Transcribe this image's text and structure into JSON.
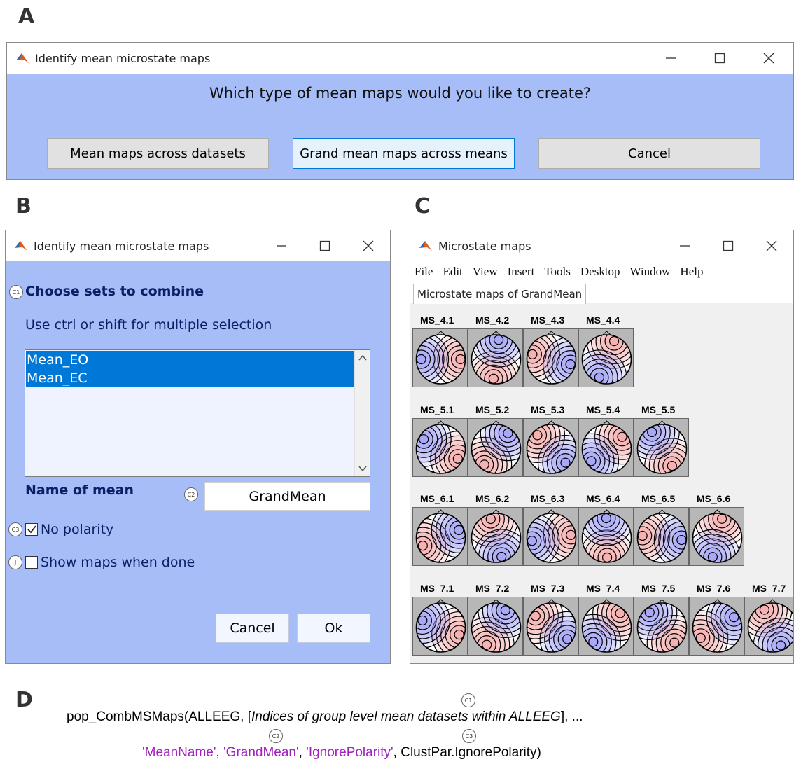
{
  "panel_letters": [
    "A",
    "B",
    "C",
    "D"
  ],
  "panel_a": {
    "window_title": "Identify mean microstate maps",
    "question": "Which type of mean maps would you like to create?",
    "buttons": [
      "Mean maps across datasets",
      "Grand mean maps across means",
      "Cancel"
    ],
    "focused_button": "Grand mean maps across means"
  },
  "panel_b": {
    "window_title": "Identify mean microstate maps",
    "heading": "Choose sets to combine",
    "heading_marker": "C1",
    "instruction": "Use ctrl or shift for multiple selection",
    "list_items": [
      "Mean_EO",
      "Mean_EC"
    ],
    "selected_items": [
      "Mean_EO",
      "Mean_EC"
    ],
    "name_label": "Name of mean",
    "name_marker": "C2",
    "name_value": "GrandMean",
    "no_polarity_label": "No polarity",
    "no_polarity_checked": true,
    "no_polarity_marker": "C3",
    "show_maps_label": "Show maps when done",
    "show_maps_checked": false,
    "show_maps_marker": "J",
    "cancel_label": "Cancel",
    "ok_label": "Ok"
  },
  "panel_c": {
    "window_title": "Microstate maps",
    "menu": [
      "File",
      "Edit",
      "View",
      "Insert",
      "Tools",
      "Desktop",
      "Window",
      "Help"
    ],
    "tab": "Microstate maps of GrandMean",
    "rows": [
      [
        "MS_4.1",
        "MS_4.2",
        "MS_4.3",
        "MS_4.4"
      ],
      [
        "MS_5.1",
        "MS_5.2",
        "MS_5.3",
        "MS_5.4",
        "MS_5.5"
      ],
      [
        "MS_6.1",
        "MS_6.2",
        "MS_6.3",
        "MS_6.4",
        "MS_6.5",
        "MS_6.6"
      ],
      [
        "MS_7.1",
        "MS_7.2",
        "MS_7.3",
        "MS_7.4",
        "MS_7.5",
        "MS_7.6",
        "MS_7.7"
      ]
    ],
    "colors": {
      "positive": "#f08a8a",
      "negative": "#7f7ff2",
      "background": "#b7b7b7"
    }
  },
  "panel_d": {
    "line1_prefix": "pop_CombMSMaps(ALLEEG, [",
    "line1_italic": "Indices of group level mean datasets within ALLEEG",
    "line1_suffix": "], ...",
    "line2_str1": "'MeanName'",
    "sep": ", ",
    "line2_str2": "'GrandMean'",
    "line2_str3": "'IgnorePolarity'",
    "line2_end": "ClustPar.IgnorePolarity)",
    "markers": [
      "C1",
      "C2",
      "C3"
    ],
    "string_color": "#a020c0"
  }
}
